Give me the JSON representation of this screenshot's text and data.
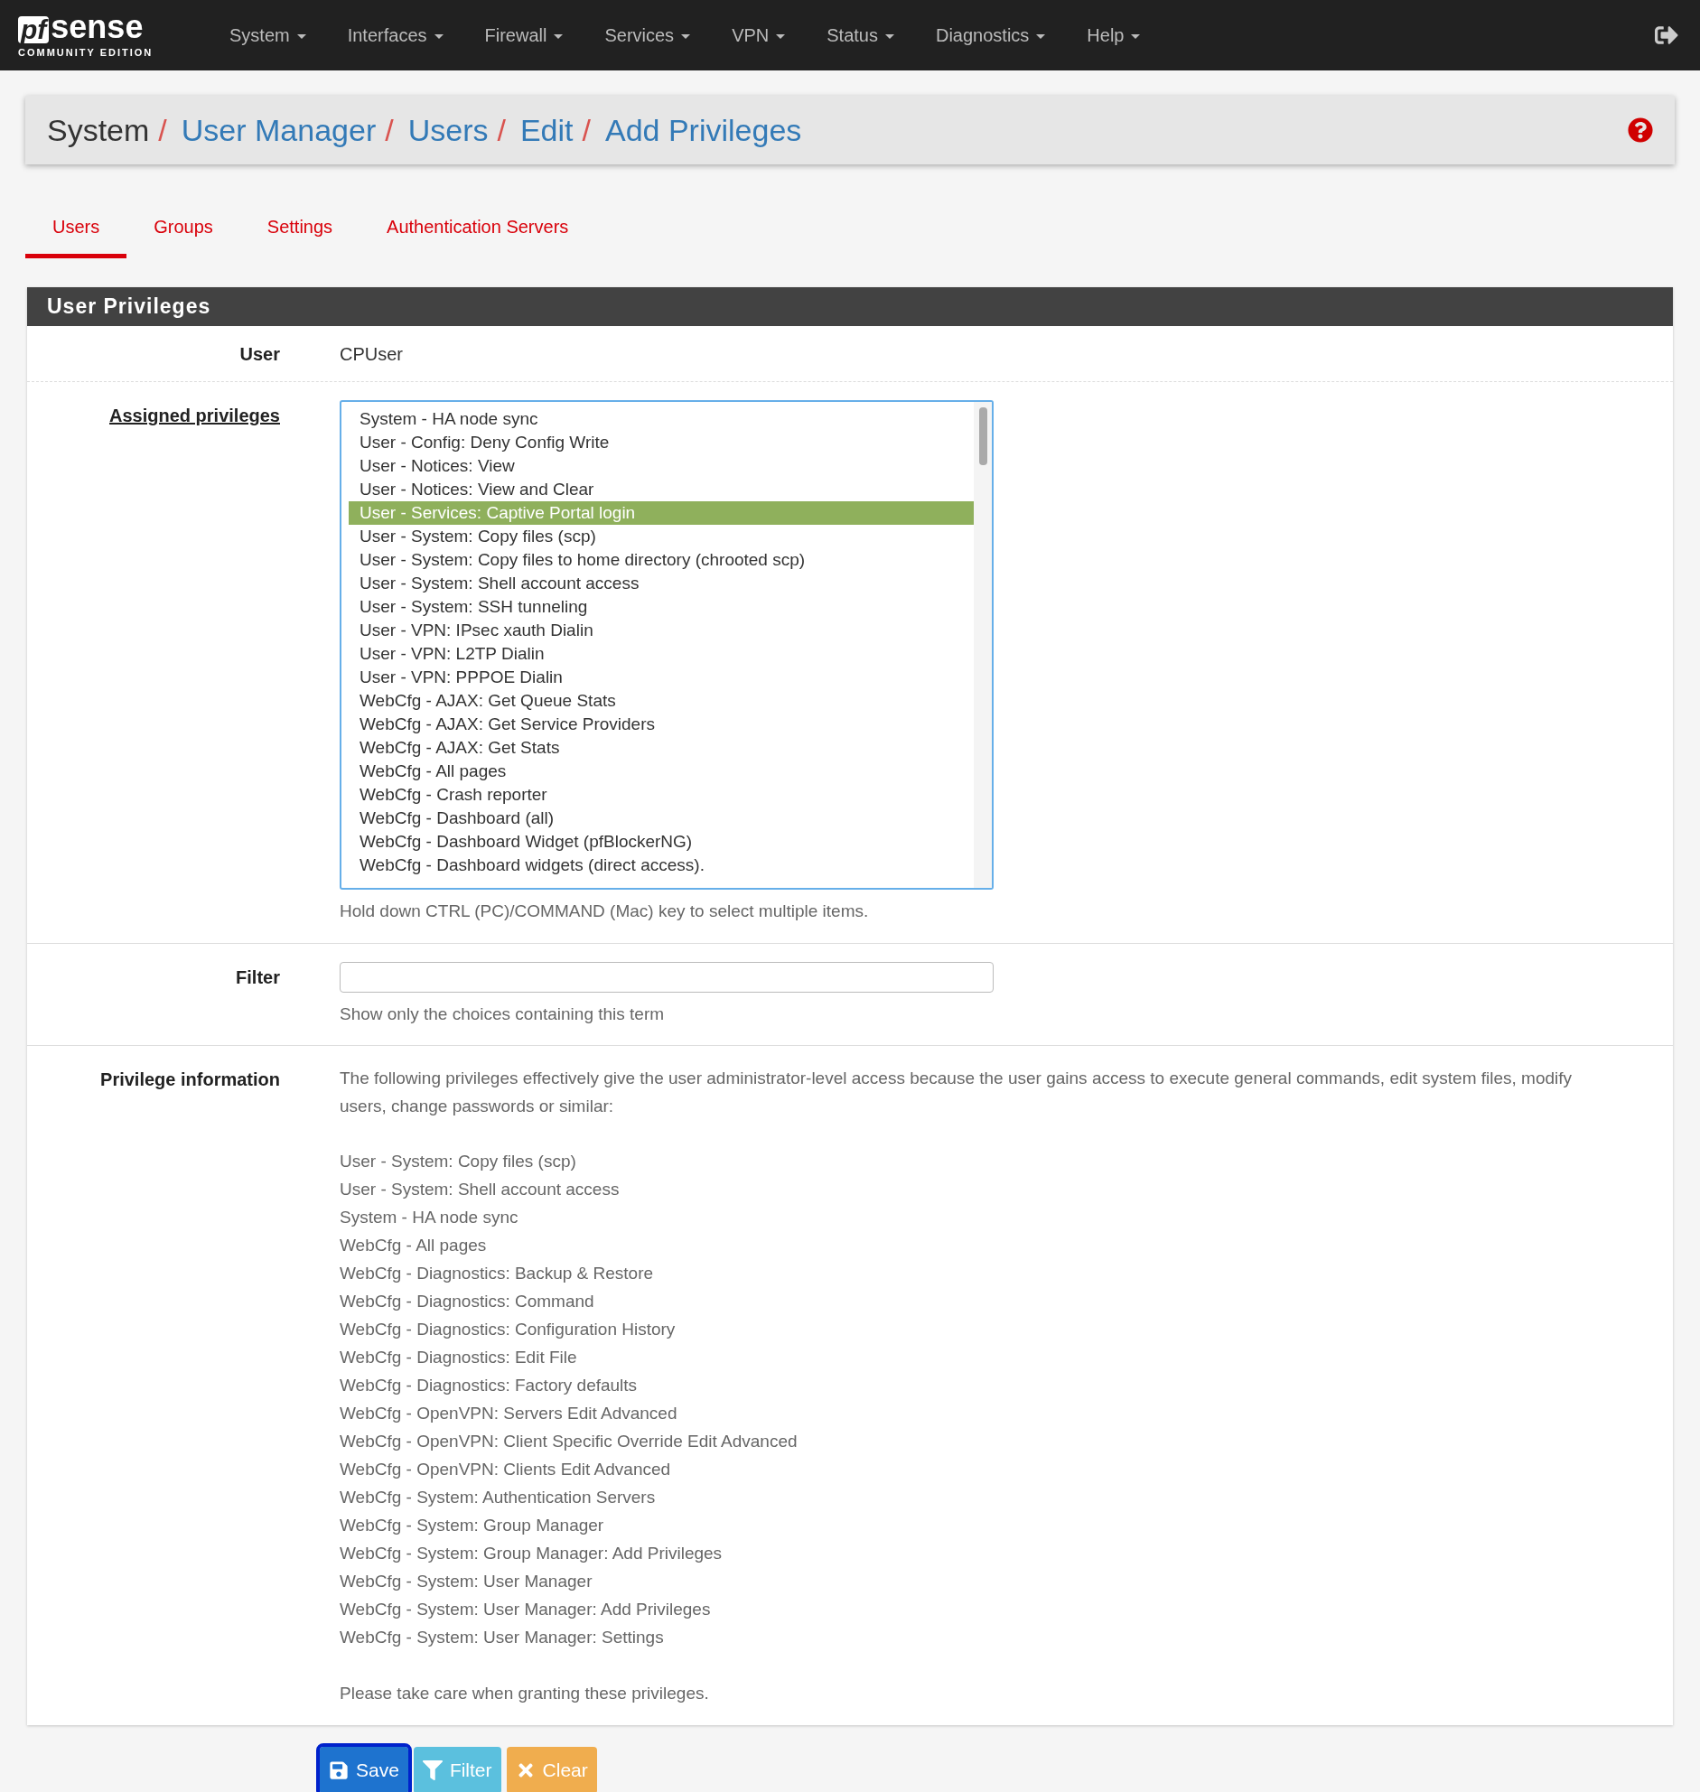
{
  "navbar": {
    "logo": {
      "brand": "sense",
      "brand_mark": "pf",
      "tagline": "COMMUNITY EDITION"
    },
    "menus": [
      "System",
      "Interfaces",
      "Firewall",
      "Services",
      "VPN",
      "Status",
      "Diagnostics",
      "Help"
    ]
  },
  "breadcrumb": [
    {
      "label": "System",
      "link": false,
      "separator": "/"
    },
    {
      "label": "User Manager",
      "link": true,
      "separator": "/"
    },
    {
      "label": "Users",
      "link": true,
      "separator": "/"
    },
    {
      "label": "Edit",
      "link": true,
      "separator": "/"
    },
    {
      "label": "Add Privileges",
      "link": true
    }
  ],
  "tabs": [
    {
      "label": "Users",
      "selected": true
    },
    {
      "label": "Groups",
      "selected": false
    },
    {
      "label": "Settings",
      "selected": false
    },
    {
      "label": "Authentication Servers",
      "selected": false
    }
  ],
  "panel": {
    "title": "User Privileges",
    "user": {
      "label": "User",
      "value": "CPUser"
    },
    "assigned": {
      "label": "Assigned privileges",
      "items": [
        {
          "label": "System - HA node sync",
          "selected": false
        },
        {
          "label": "User - Config: Deny Config Write",
          "selected": false
        },
        {
          "label": "User - Notices: View",
          "selected": false
        },
        {
          "label": "User - Notices: View and Clear",
          "selected": false
        },
        {
          "label": "User - Services: Captive Portal login",
          "selected": true
        },
        {
          "label": "User - System: Copy files (scp)",
          "selected": false
        },
        {
          "label": "User - System: Copy files to home directory (chrooted scp)",
          "selected": false
        },
        {
          "label": "User - System: Shell account access",
          "selected": false
        },
        {
          "label": "User - System: SSH tunneling",
          "selected": false
        },
        {
          "label": "User - VPN: IPsec xauth Dialin",
          "selected": false
        },
        {
          "label": "User - VPN: L2TP Dialin",
          "selected": false
        },
        {
          "label": "User - VPN: PPPOE Dialin",
          "selected": false
        },
        {
          "label": "WebCfg - AJAX: Get Queue Stats",
          "selected": false
        },
        {
          "label": "WebCfg - AJAX: Get Service Providers",
          "selected": false
        },
        {
          "label": "WebCfg - AJAX: Get Stats",
          "selected": false
        },
        {
          "label": "WebCfg - All pages",
          "selected": false
        },
        {
          "label": "WebCfg - Crash reporter",
          "selected": false
        },
        {
          "label": "WebCfg - Dashboard (all)",
          "selected": false
        },
        {
          "label": "WebCfg - Dashboard Widget (pfBlockerNG)",
          "selected": false
        },
        {
          "label": "WebCfg - Dashboard widgets (direct access).",
          "selected": false
        }
      ],
      "help": "Hold down CTRL (PC)/COMMAND (Mac) key to select multiple items."
    },
    "filter": {
      "label": "Filter",
      "help": "Show only the choices containing this term"
    },
    "info": {
      "label": "Privilege information",
      "intro": "The following privileges effectively give the user administrator-level access because the user gains access to execute general commands, edit system files, modify users, change passwords or similar:",
      "items": [
        "User - System: Copy files (scp)",
        "User - System: Shell account access",
        "System - HA node sync",
        "WebCfg - All pages",
        "WebCfg - Diagnostics: Backup & Restore",
        "WebCfg - Diagnostics: Command",
        "WebCfg - Diagnostics: Configuration History",
        "WebCfg - Diagnostics: Edit File",
        "WebCfg - Diagnostics: Factory defaults",
        "WebCfg - OpenVPN: Servers Edit Advanced",
        "WebCfg - OpenVPN: Client Specific Override Edit Advanced",
        "WebCfg - OpenVPN: Clients Edit Advanced",
        "WebCfg - System: Authentication Servers",
        "WebCfg - System: Group Manager",
        "WebCfg - System: Group Manager: Add Privileges",
        "WebCfg - System: User Manager",
        "WebCfg - System: User Manager: Add Privileges",
        "WebCfg - System: User Manager: Settings"
      ],
      "note": "Please take care when granting these privileges."
    }
  },
  "buttons": [
    {
      "kind": "save",
      "label": "Save",
      "focused": true
    },
    {
      "kind": "filter",
      "label": "Filter",
      "focused": false
    },
    {
      "kind": "clear",
      "label": "Clear",
      "focused": false
    }
  ]
}
